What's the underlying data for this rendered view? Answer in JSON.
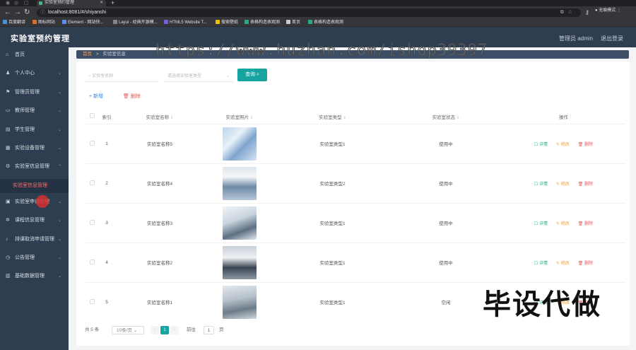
{
  "browser": {
    "tab_title": "实验室预约管理",
    "url": "localhost:8081/#/shiyanshi",
    "profile_label": "无痕模式",
    "bookmarks": [
      "百度翻译",
      "图标网站",
      "Element - 网站快...",
      "Layui - 经典开源模...",
      "HTML5 Website T...",
      "搜索壁纸",
      "表格构造表观测",
      "首页",
      "表格构造表观测"
    ]
  },
  "app": {
    "title": "实验室预约管理",
    "user_label": "管理员 admin",
    "logout_label": "退出登录"
  },
  "sidebar": {
    "items": [
      {
        "label": "首页",
        "icon": "home-icon",
        "has_arrow": false
      },
      {
        "label": "个人中心",
        "icon": "user-icon",
        "has_arrow": true
      },
      {
        "label": "管理员管理",
        "icon": "flag-icon",
        "has_arrow": true
      },
      {
        "label": "教师管理",
        "icon": "chat-icon",
        "has_arrow": true
      },
      {
        "label": "学生管理",
        "icon": "doc-icon",
        "has_arrow": true
      },
      {
        "label": "实验设备管理",
        "icon": "tool-icon",
        "has_arrow": true
      },
      {
        "label": "实验室信息管理",
        "icon": "settings-icon",
        "has_arrow": true,
        "expanded": true
      },
      {
        "label": "实验室申请管理",
        "icon": "list-icon",
        "has_arrow": true
      },
      {
        "label": "课程信息管理",
        "icon": "gear-icon",
        "has_arrow": true
      },
      {
        "label": "排课取消申请管理",
        "icon": "mic-icon",
        "has_arrow": true
      },
      {
        "label": "公告管理",
        "icon": "clock-icon",
        "has_arrow": true
      },
      {
        "label": "基础数据管理",
        "icon": "chart-icon",
        "has_arrow": true
      }
    ],
    "active_submenu": "实验室信息管理"
  },
  "breadcrumb": {
    "home": "首页",
    "separator": ">",
    "current": "实验室信息"
  },
  "search": {
    "name_placeholder": "实验室名称",
    "type_placeholder": "请选择实验室类型",
    "search_label": "查询"
  },
  "actions": {
    "add_label": "新增",
    "delete_label": "删除"
  },
  "table": {
    "headers": [
      "索引",
      "实验室名称",
      "实验室照片",
      "实验室类型",
      "实验室状态",
      "操作"
    ],
    "rows": [
      {
        "index": "1",
        "name": "实验室名称5",
        "type": "实验室类型1",
        "status": "使用中"
      },
      {
        "index": "2",
        "name": "实验室名称4",
        "type": "实验室类型2",
        "status": "使用中"
      },
      {
        "index": "3",
        "name": "实验室名称3",
        "type": "实验室类型1",
        "status": "使用中"
      },
      {
        "index": "4",
        "name": "实验室名称2",
        "type": "实验室类型1",
        "status": "使用中"
      },
      {
        "index": "5",
        "name": "实验室名称1",
        "type": "实验室类型1",
        "status": "空闲"
      }
    ],
    "row_actions": {
      "view": "详情",
      "edit": "修改",
      "delete": "删除"
    }
  },
  "pagination": {
    "total_label": "共 5 条",
    "page_size": "10条/页",
    "current_page": "1",
    "goto_label": "前往",
    "goto_value": "1",
    "page_suffix": "页"
  },
  "watermarks": {
    "url": "https://www.huzhan.com/ishop39397",
    "slogan": "毕设代做"
  },
  "colors": {
    "sidebar_bg": "#2e3e50",
    "accent": "#17a3a0",
    "danger": "#e05b5b",
    "warning": "#e6a23c",
    "success": "#2ea87e",
    "link": "#3b7ddd"
  }
}
